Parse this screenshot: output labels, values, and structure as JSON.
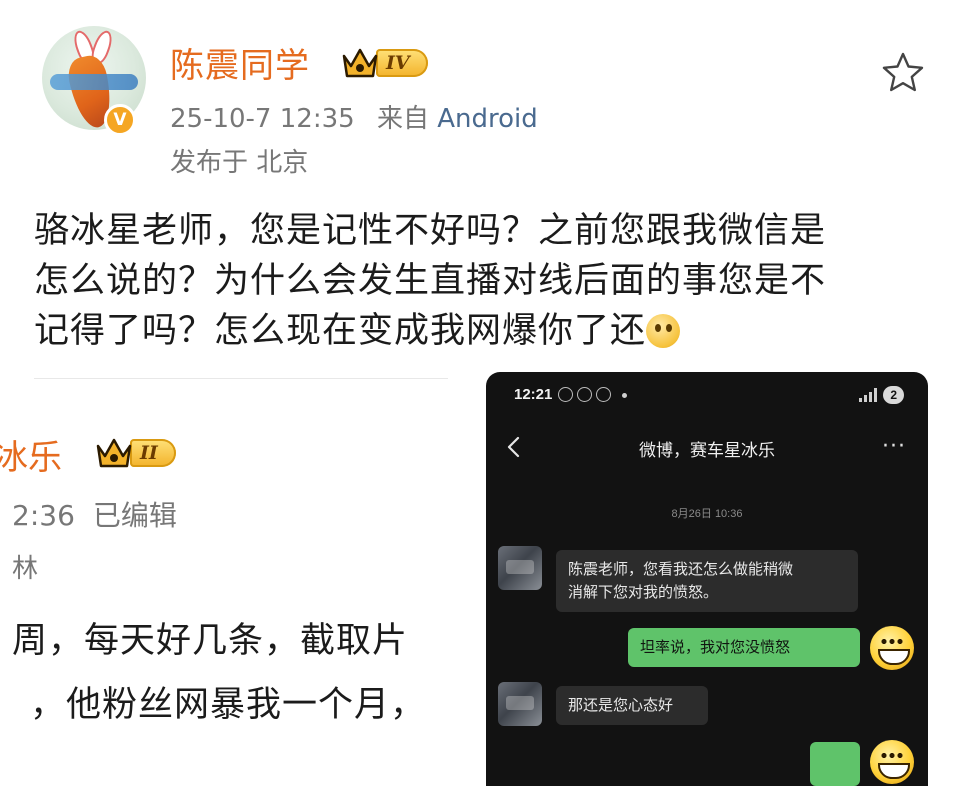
{
  "post1": {
    "author": "陈震同学",
    "level": "IV",
    "date": "25-10-7 12:35",
    "from_prefix": "来自",
    "source": "Android",
    "location": "发布于 北京",
    "text_lines": [
      "骆冰星老师，您是记性不好吗？之前您跟我微信是",
      "怎么说的？为什么会发生直播对线后面的事您是不",
      "记得了吗？怎么现在变成我网爆你了还"
    ]
  },
  "post2": {
    "author": "冰乐",
    "level": "II",
    "time": "2:36",
    "edited": "已编辑",
    "location": "林",
    "text_lines": [
      "周，每天好几条，截取片",
      "，他粉丝网暴我一个月，"
    ]
  },
  "phone": {
    "status_time": "12:21",
    "badge": "2",
    "chat_title": "微博，赛车星冰乐",
    "date_stamp": "8月26日 10:36",
    "messages": [
      {
        "dir": "in",
        "lines": [
          "陈震老师，您看我还怎么做能稍微",
          "消解下您对我的愤怒。"
        ]
      },
      {
        "dir": "out",
        "text": "坦率说，我对您没愤怒"
      },
      {
        "dir": "in",
        "text": "那还是您心态好"
      }
    ]
  },
  "icons": {
    "favorite": "star-outline-icon",
    "verified": "verified-v-icon",
    "crown": "crown-icon"
  },
  "colors": {
    "username": "#e56b1f",
    "meta": "#777777",
    "source_link": "#4a6a8f",
    "chat_bg": "#121212",
    "bubble_in": "#2c2c2c",
    "bubble_out": "#5fc36a"
  }
}
